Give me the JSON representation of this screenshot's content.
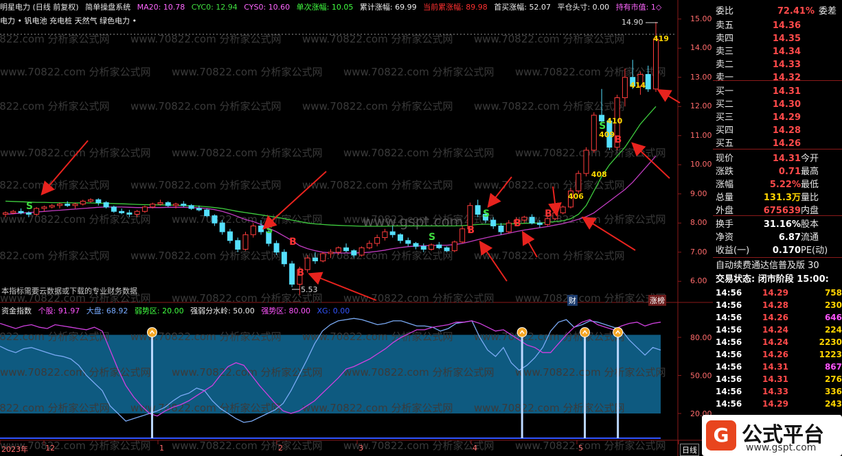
{
  "header": {
    "title": "明星电力 (日线 前复权)",
    "system": "简单操盘系统",
    "ma20": "MA20: 10.78",
    "cyc0": "CYC0: 12.94",
    "cys0": "CYS0: 10.60",
    "rise_once": "单次涨幅: 10.05",
    "rise_total": "累计涨幅: 69.99",
    "cur_total": "当前累涨幅: 89.98",
    "first_buy": "首买涨幅: 52.07",
    "close_pos": "平仓头寸: 0.00",
    "hold_value": "持有市值: 1◇",
    "concepts": "电力 • 钒电池 充电桩 天然气 绿色电力 •"
  },
  "note": "本指标需要云数据或下载的专业财务数据",
  "ind_header": {
    "title": "资金指数",
    "stock": "个股: 91.97",
    "market": "大盘: 68.92",
    "weak": "弱势区: 20.00",
    "divide": "强弱分水岭: 50.00",
    "strong": "强势区: 80.00",
    "xg": "XG: 0.00"
  },
  "badges": {
    "cai": "财",
    "zb": "涨榜"
  },
  "watermark": "www.70822.com 分析家公式网",
  "watermark2": "www.gspt.com",
  "logo": {
    "text": "公式平台",
    "url": "www.gspt.com"
  },
  "panel": {
    "wb": {
      "label": "委比",
      "value": "72.41%",
      "right": "委差"
    },
    "asks": [
      {
        "label": "卖五",
        "price": "14.36"
      },
      {
        "label": "卖四",
        "price": "14.35"
      },
      {
        "label": "卖三",
        "price": "14.34"
      },
      {
        "label": "卖二",
        "price": "14.33"
      },
      {
        "label": "卖一",
        "price": "14.32"
      }
    ],
    "bids": [
      {
        "label": "买一",
        "price": "14.31"
      },
      {
        "label": "买二",
        "price": "14.30"
      },
      {
        "label": "买三",
        "price": "14.29"
      },
      {
        "label": "买四",
        "price": "14.28"
      },
      {
        "label": "买五",
        "price": "14.26"
      }
    ],
    "quote": [
      {
        "label": "现价",
        "value": "14.31",
        "right": "今开"
      },
      {
        "label": "涨跌",
        "value": "0.71",
        "right": "最高"
      },
      {
        "label": "涨幅",
        "value": "5.22%",
        "right": "最低"
      },
      {
        "label": "总量",
        "value": "131.3万",
        "right": "量比"
      },
      {
        "label": "外盘",
        "value": "675639",
        "right": "内盘"
      }
    ],
    "fin": [
      {
        "label": "换手",
        "value": "31.16%",
        "right": "股本"
      },
      {
        "label": "净资",
        "value": "6.87",
        "right": "流通"
      },
      {
        "label": "收益(一)",
        "value": "0.170",
        "right": "PE(动)"
      }
    ],
    "ad": "自动续费通达信普及版 30",
    "status": "交易状态: 闭市阶段 15:00:",
    "ticks": [
      {
        "t": "14:56",
        "p": "14.29",
        "v": "758"
      },
      {
        "t": "14:56",
        "p": "14.28",
        "v": "230"
      },
      {
        "t": "14:56",
        "p": "14.26",
        "v": "646"
      },
      {
        "t": "14:56",
        "p": "14.24",
        "v": "224"
      },
      {
        "t": "14:56",
        "p": "14.24",
        "v": "2230"
      },
      {
        "t": "14:56",
        "p": "14.26",
        "v": "1223"
      },
      {
        "t": "14:56",
        "p": "14.31",
        "v": "867"
      },
      {
        "t": "14:56",
        "p": "14.31",
        "v": "276"
      },
      {
        "t": "14:56",
        "p": "14.33",
        "v": "336"
      },
      {
        "t": "14:56",
        "p": "14.29",
        "v": "243"
      }
    ]
  },
  "chart_data": {
    "type": "candlestick",
    "price_axis": {
      "ticks": [
        "15.00",
        "14.00",
        "13.00",
        "12.00",
        "11.00",
        "10.00",
        "9.00",
        "8.00",
        "7.00",
        "6.00"
      ],
      "ylim": [
        5.3,
        15.3
      ]
    },
    "time_axis": [
      "2023年",
      "12",
      "1",
      "2",
      "3",
      "4",
      "5",
      "日线"
    ],
    "annotations": {
      "high": "14.90",
      "low": "5.53"
    },
    "signal_labels": [
      "S",
      "B",
      "S",
      "B",
      "S",
      "B",
      "B",
      "B",
      "S",
      "S",
      "B",
      "408",
      "406",
      "410",
      "409",
      "414",
      "419"
    ],
    "candles": [
      [
        8.3,
        8.4,
        8.2,
        8.35
      ],
      [
        8.35,
        8.45,
        8.3,
        8.4
      ],
      [
        8.4,
        8.5,
        8.3,
        8.35
      ],
      [
        8.35,
        8.4,
        8.2,
        8.3
      ],
      [
        8.3,
        8.55,
        8.25,
        8.5
      ],
      [
        8.5,
        8.6,
        8.4,
        8.55
      ],
      [
        8.55,
        8.65,
        8.5,
        8.6
      ],
      [
        8.6,
        8.7,
        8.5,
        8.65
      ],
      [
        8.65,
        8.75,
        8.55,
        8.6
      ],
      [
        8.6,
        8.7,
        8.5,
        8.65
      ],
      [
        8.65,
        8.8,
        8.6,
        8.75
      ],
      [
        8.75,
        8.85,
        8.7,
        8.8
      ],
      [
        8.8,
        8.85,
        8.6,
        8.7
      ],
      [
        8.7,
        8.75,
        8.5,
        8.55
      ],
      [
        8.55,
        8.6,
        8.35,
        8.4
      ],
      [
        8.4,
        8.5,
        8.3,
        8.35
      ],
      [
        8.35,
        8.45,
        8.2,
        8.3
      ],
      [
        8.3,
        8.45,
        8.2,
        8.4
      ],
      [
        8.4,
        8.6,
        8.35,
        8.55
      ],
      [
        8.55,
        8.7,
        8.5,
        8.65
      ],
      [
        8.65,
        8.8,
        8.6,
        8.7
      ],
      [
        8.7,
        8.75,
        8.55,
        8.6
      ],
      [
        8.6,
        8.7,
        8.5,
        8.65
      ],
      [
        8.65,
        8.75,
        8.55,
        8.6
      ],
      [
        8.6,
        8.65,
        8.45,
        8.5
      ],
      [
        8.5,
        8.6,
        8.4,
        8.45
      ],
      [
        8.45,
        8.5,
        8.2,
        8.25
      ],
      [
        8.25,
        8.3,
        7.9,
        8.0
      ],
      [
        8.0,
        8.1,
        7.6,
        7.7
      ],
      [
        7.7,
        7.8,
        7.3,
        7.4
      ],
      [
        7.4,
        7.5,
        7.0,
        7.1
      ],
      [
        7.1,
        7.7,
        7.05,
        7.6
      ],
      [
        7.6,
        8.0,
        7.5,
        7.9
      ],
      [
        7.9,
        8.1,
        7.6,
        7.7
      ],
      [
        7.7,
        7.75,
        7.2,
        7.3
      ],
      [
        7.3,
        7.4,
        6.9,
        7.0
      ],
      [
        7.0,
        7.1,
        6.5,
        6.6
      ],
      [
        6.6,
        6.7,
        5.8,
        5.9
      ],
      [
        5.9,
        6.5,
        5.53,
        6.4
      ],
      [
        6.4,
        6.9,
        6.3,
        6.8
      ],
      [
        6.8,
        7.0,
        6.6,
        6.7
      ],
      [
        6.7,
        7.0,
        6.65,
        6.95
      ],
      [
        6.95,
        7.1,
        6.8,
        7.0
      ],
      [
        7.0,
        7.2,
        6.9,
        7.15
      ],
      [
        7.15,
        7.3,
        7.0,
        7.05
      ],
      [
        7.05,
        7.1,
        6.8,
        6.9
      ],
      [
        6.9,
        7.2,
        6.85,
        7.15
      ],
      [
        7.15,
        7.4,
        7.1,
        7.3
      ],
      [
        7.3,
        7.6,
        7.2,
        7.5
      ],
      [
        7.5,
        7.8,
        7.4,
        7.7
      ],
      [
        7.7,
        7.9,
        7.5,
        7.6
      ],
      [
        7.6,
        7.65,
        7.3,
        7.4
      ],
      [
        7.4,
        7.5,
        7.2,
        7.3
      ],
      [
        7.3,
        7.35,
        7.1,
        7.2
      ],
      [
        7.2,
        7.3,
        7.0,
        7.1
      ],
      [
        7.1,
        7.3,
        7.05,
        7.25
      ],
      [
        7.25,
        7.35,
        7.1,
        7.15
      ],
      [
        7.15,
        7.2,
        7.0,
        7.05
      ],
      [
        7.05,
        7.4,
        7.0,
        7.35
      ],
      [
        7.35,
        7.9,
        7.3,
        7.8
      ],
      [
        7.8,
        8.7,
        7.7,
        8.6
      ],
      [
        8.6,
        8.8,
        8.2,
        8.3
      ],
      [
        8.3,
        8.4,
        8.0,
        8.1
      ],
      [
        8.1,
        8.2,
        7.8,
        7.9
      ],
      [
        7.9,
        8.0,
        7.6,
        7.7
      ],
      [
        7.7,
        8.1,
        7.65,
        8.0
      ],
      [
        8.0,
        8.2,
        7.9,
        8.1
      ],
      [
        8.1,
        8.25,
        8.0,
        8.2
      ],
      [
        8.2,
        8.3,
        7.95,
        8.0
      ],
      [
        8.0,
        8.1,
        7.85,
        7.95
      ],
      [
        7.95,
        8.2,
        7.9,
        8.15
      ],
      [
        8.15,
        8.4,
        8.1,
        8.35
      ],
      [
        8.35,
        8.6,
        8.3,
        8.55
      ],
      [
        8.55,
        9.2,
        8.5,
        9.1
      ],
      [
        9.1,
        9.8,
        9.0,
        9.7
      ],
      [
        9.7,
        10.6,
        9.6,
        10.5
      ],
      [
        10.5,
        11.8,
        10.4,
        11.7
      ],
      [
        11.7,
        12.6,
        11.4,
        11.5
      ],
      [
        11.5,
        11.6,
        10.5,
        10.6
      ],
      [
        10.6,
        12.4,
        10.5,
        12.3
      ],
      [
        12.3,
        13.3,
        12.0,
        13.0
      ],
      [
        13.0,
        13.6,
        12.6,
        12.7
      ],
      [
        12.7,
        13.2,
        12.4,
        13.1
      ],
      [
        13.1,
        13.4,
        12.5,
        12.6
      ],
      [
        12.6,
        14.9,
        12.5,
        14.31
      ]
    ],
    "ma_green": [
      8.75,
      8.74,
      8.73,
      8.72,
      8.71,
      8.71,
      8.7,
      8.7,
      8.7,
      8.69,
      8.69,
      8.69,
      8.68,
      8.68,
      8.67,
      8.66,
      8.65,
      8.64,
      8.63,
      8.63,
      8.62,
      8.62,
      8.61,
      8.6,
      8.59,
      8.58,
      8.56,
      8.53,
      8.5,
      8.45,
      8.4,
      8.36,
      8.32,
      8.28,
      8.24,
      8.2,
      8.15,
      8.1,
      8.05,
      8.0,
      7.97,
      7.95,
      7.93,
      7.92,
      7.91,
      7.9,
      7.89,
      7.89,
      7.89,
      7.89,
      7.9,
      7.9,
      7.9,
      7.9,
      7.9,
      7.9,
      7.9,
      7.9,
      7.9,
      7.91,
      7.93,
      7.95,
      7.96,
      7.96,
      7.96,
      7.97,
      7.98,
      7.99,
      8.0,
      8.0,
      8.02,
      8.05,
      8.08,
      8.15,
      8.3,
      8.6,
      9.1,
      9.6,
      10.0,
      10.3,
      10.6,
      11.0,
      11.4,
      11.7,
      12.0
    ],
    "ma_magenta": [
      8.3,
      8.32,
      8.34,
      8.36,
      8.38,
      8.4,
      8.42,
      8.44,
      8.46,
      8.48,
      8.5,
      8.52,
      8.54,
      8.55,
      8.55,
      8.55,
      8.54,
      8.53,
      8.53,
      8.53,
      8.53,
      8.54,
      8.54,
      8.54,
      8.53,
      8.52,
      8.5,
      8.46,
      8.4,
      8.32,
      8.22,
      8.12,
      8.05,
      7.95,
      7.82,
      7.7,
      7.55,
      7.4,
      7.22,
      7.12,
      7.05,
      7.0,
      6.98,
      6.97,
      6.97,
      6.97,
      6.98,
      7.0,
      7.03,
      7.07,
      7.12,
      7.16,
      7.19,
      7.21,
      7.22,
      7.23,
      7.24,
      7.24,
      7.26,
      7.3,
      7.36,
      7.43,
      7.49,
      7.55,
      7.6,
      7.65,
      7.71,
      7.76,
      7.8,
      7.84,
      7.88,
      7.93,
      7.98,
      8.05,
      8.13,
      8.22,
      8.35,
      8.55,
      8.75,
      8.95,
      9.15,
      9.4,
      9.7,
      10.0,
      10.3
    ],
    "ind_axis": {
      "ticks": [
        "80.00",
        "50.00",
        "20.00"
      ],
      "ylim": [
        0,
        100
      ]
    },
    "ind_stock": [
      91,
      89,
      87,
      89,
      90,
      88,
      87,
      90,
      89,
      88,
      87,
      86,
      88,
      85,
      70,
      55,
      42,
      33,
      26,
      20,
      18,
      22,
      25,
      27,
      30,
      34,
      38,
      42,
      50,
      57,
      60,
      58,
      50,
      42,
      35,
      28,
      22,
      20,
      22,
      26,
      30,
      36,
      42,
      48,
      55,
      57,
      60,
      63,
      67,
      71,
      76,
      80,
      83,
      86,
      86,
      88,
      89,
      90,
      92,
      92,
      93,
      91,
      88,
      85,
      86,
      82,
      78,
      74,
      72,
      68,
      68,
      75,
      82,
      88,
      92,
      94,
      90,
      88,
      86,
      89,
      91,
      92,
      89,
      91,
      92
    ],
    "ind_market": [
      73,
      70,
      68,
      71,
      72,
      70,
      68,
      66,
      65,
      63,
      58,
      50,
      44,
      38,
      26,
      20,
      14,
      16,
      18,
      20,
      22,
      25,
      30,
      34,
      36,
      40,
      38,
      30,
      24,
      20,
      16,
      13,
      14,
      17,
      20,
      23,
      28,
      38,
      50,
      62,
      75,
      85,
      90,
      93,
      94,
      95,
      94,
      92,
      90,
      91,
      93,
      93,
      91,
      89,
      89,
      88,
      85,
      87,
      91,
      92,
      93,
      80,
      70,
      65,
      72,
      60,
      54,
      58,
      64,
      72,
      85,
      92,
      94,
      88,
      90,
      93,
      92,
      90,
      88,
      86,
      78,
      72,
      66,
      72,
      70
    ],
    "signals_at": [
      0.225,
      0.785,
      0.88,
      0.93
    ]
  }
}
